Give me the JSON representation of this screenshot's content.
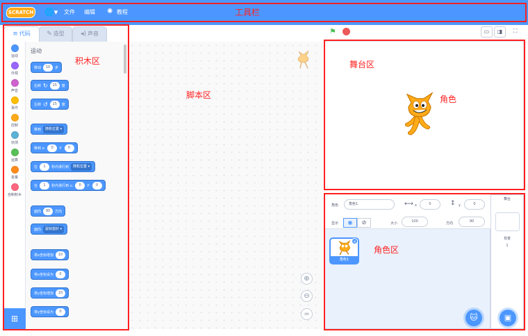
{
  "menubar": {
    "logo_text": "SCRATCH",
    "file_label": "文件",
    "edit_label": "编辑",
    "tutorials_label": "教程"
  },
  "tabs": [
    {
      "label": "代码"
    },
    {
      "label": "造型"
    },
    {
      "label": "声音"
    }
  ],
  "categories": [
    {
      "label": "运动",
      "color": "#4c97ff"
    },
    {
      "label": "外观",
      "color": "#9966ff"
    },
    {
      "label": "声音",
      "color": "#cf63cf"
    },
    {
      "label": "事件",
      "color": "#ffbf00"
    },
    {
      "label": "控制",
      "color": "#ffab19"
    },
    {
      "label": "侦测",
      "color": "#5cb1d6"
    },
    {
      "label": "运算",
      "color": "#59c059"
    },
    {
      "label": "变量",
      "color": "#ff8c1a"
    },
    {
      "label": "自制积木",
      "color": "#ff6680"
    }
  ],
  "palette": {
    "section_title": "运动",
    "move": {
      "prefix": "移动",
      "steps": "10",
      "suffix": "步"
    },
    "turn_right": {
      "prefix": "右转",
      "degrees": "15",
      "suffix": "度"
    },
    "turn_left": {
      "prefix": "左转",
      "degrees": "15",
      "suffix": "度"
    },
    "goto": {
      "prefix": "移到",
      "menu": "随机位置"
    },
    "goto_xy": {
      "prefix": "移到 x:",
      "x": "0",
      "ylabel": "y:",
      "y": "0"
    },
    "glide": {
      "prefix": "在",
      "secs": "1",
      "mid": "秒内滑行到",
      "menu": "随机位置"
    },
    "glide_xy": {
      "prefix": "在",
      "secs": "1",
      "mid": "秒内滑行到 x:",
      "x": "0",
      "ylabel": "y:",
      "y": "0"
    },
    "point_dir": {
      "prefix": "面向",
      "dir": "90",
      "suffix": "方向"
    },
    "point_towards": {
      "prefix": "面向",
      "menu": "鼠标指针"
    },
    "change_x": {
      "prefix": "将x坐标增加",
      "value": "10"
    },
    "set_x": {
      "prefix": "将x坐标设为",
      "value": "0"
    },
    "change_y": {
      "prefix": "将y坐标增加",
      "value": "10"
    },
    "set_y": {
      "prefix": "将y坐标设为",
      "value": "0"
    }
  },
  "sprite_info": {
    "sprite_label": "角色",
    "sprite_name": "角色1",
    "x_label": "x",
    "x_value": "0",
    "y_label": "y",
    "y_value": "0",
    "show_label": "显示",
    "size_label": "大小",
    "size_value": "100",
    "direction_label": "方向",
    "direction_value": "90"
  },
  "sprite_list": [
    {
      "name": "角色1"
    }
  ],
  "stage_pane": {
    "title": "舞台",
    "backdrops_label": "背景",
    "backdrops_count": "1"
  },
  "annotations": {
    "toolbar": "工具栏",
    "blocks": "积木区",
    "script": "脚本区",
    "stage": "舞台区",
    "sprite": "角色",
    "sprite_area": "角色区"
  },
  "colors": {
    "menubar": "#4c97ff",
    "motion_block": "#4c97ff",
    "annotation": "#ff1f1f"
  },
  "icons": {
    "flag": "green-flag-icon",
    "stop": "stop-icon",
    "globe": "globe-icon",
    "bulb": "bulb-icon"
  }
}
